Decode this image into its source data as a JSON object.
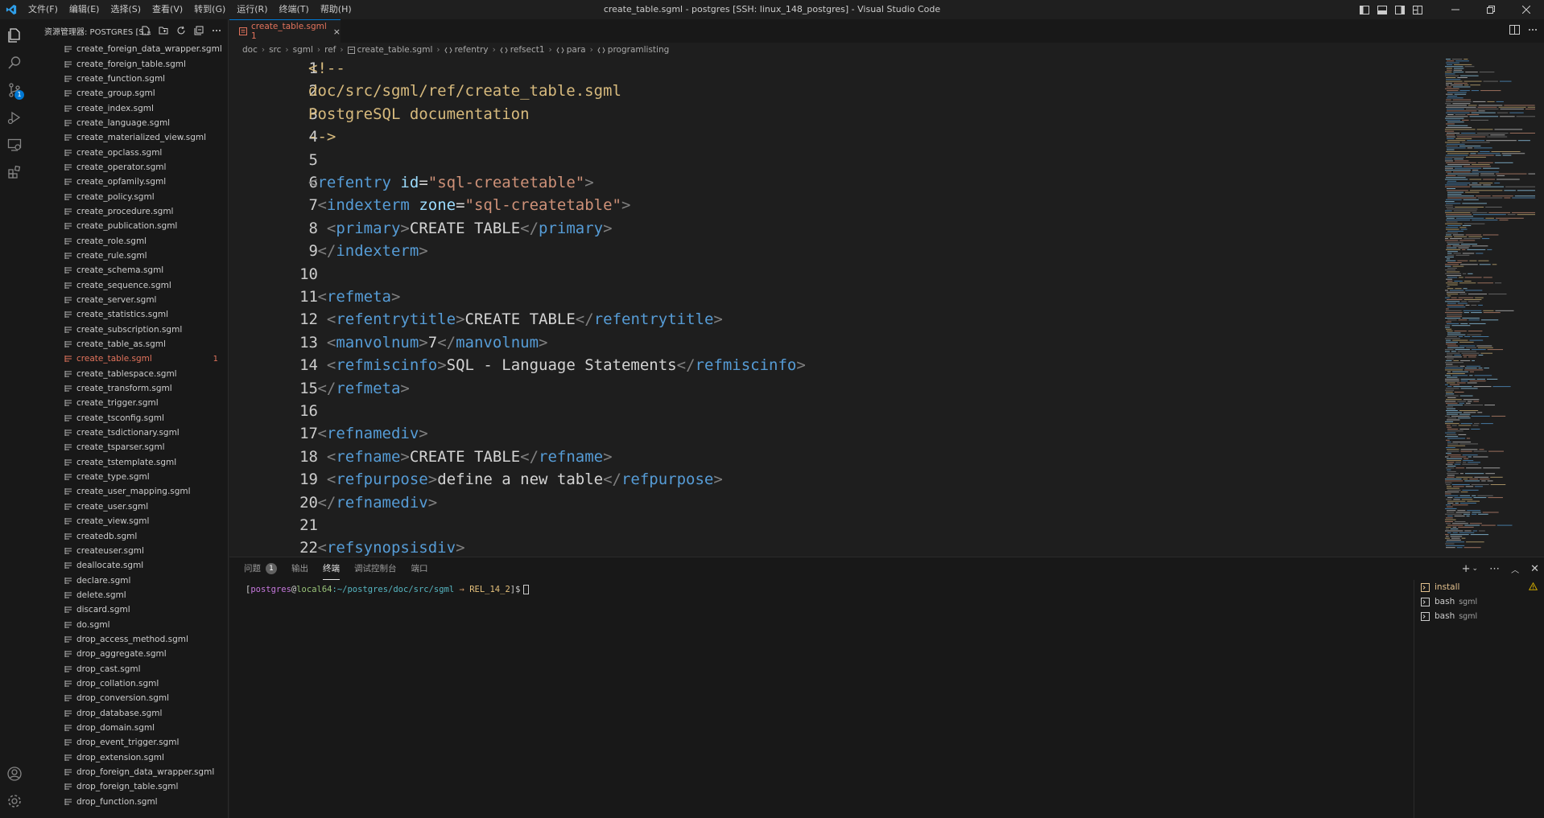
{
  "window": {
    "title": "create_table.sgml - postgres [SSH: linux_148_postgres] - Visual Studio Code",
    "menu": [
      "文件(F)",
      "编辑(E)",
      "选择(S)",
      "查看(V)",
      "转到(G)",
      "运行(R)",
      "终端(T)",
      "帮助(H)"
    ]
  },
  "sidebar": {
    "header": "资源管理器: POSTGRES [S...",
    "files": [
      "create_foreign_data_wrapper.sgml",
      "create_foreign_table.sgml",
      "create_function.sgml",
      "create_group.sgml",
      "create_index.sgml",
      "create_language.sgml",
      "create_materialized_view.sgml",
      "create_opclass.sgml",
      "create_operator.sgml",
      "create_opfamily.sgml",
      "create_policy.sgml",
      "create_procedure.sgml",
      "create_publication.sgml",
      "create_role.sgml",
      "create_rule.sgml",
      "create_schema.sgml",
      "create_sequence.sgml",
      "create_server.sgml",
      "create_statistics.sgml",
      "create_subscription.sgml",
      "create_table_as.sgml",
      "create_table.sgml",
      "create_tablespace.sgml",
      "create_transform.sgml",
      "create_trigger.sgml",
      "create_tsconfig.sgml",
      "create_tsdictionary.sgml",
      "create_tsparser.sgml",
      "create_tstemplate.sgml",
      "create_type.sgml",
      "create_user_mapping.sgml",
      "create_user.sgml",
      "create_view.sgml",
      "createdb.sgml",
      "createuser.sgml",
      "deallocate.sgml",
      "declare.sgml",
      "delete.sgml",
      "discard.sgml",
      "do.sgml",
      "drop_access_method.sgml",
      "drop_aggregate.sgml",
      "drop_cast.sgml",
      "drop_collation.sgml",
      "drop_conversion.sgml",
      "drop_database.sgml",
      "drop_domain.sgml",
      "drop_event_trigger.sgml",
      "drop_extension.sgml",
      "drop_foreign_data_wrapper.sgml",
      "drop_foreign_table.sgml",
      "drop_function.sgml"
    ],
    "active_badge": "1"
  },
  "tab": {
    "label": "create_table.sgml 1",
    "close": "×"
  },
  "breadcrumb": [
    "doc",
    "src",
    "sgml",
    "ref",
    "create_table.sgml",
    "refentry",
    "refsect1",
    "para",
    "programlisting"
  ],
  "editor": {
    "line_numbers": [
      "1",
      "2",
      "3",
      "4",
      "5",
      "6",
      "7",
      "8",
      "9",
      "10",
      "11",
      "12",
      "13",
      "14",
      "15",
      "16",
      "17",
      "18",
      "19",
      "20",
      "21",
      "22"
    ]
  },
  "panel": {
    "tabs": [
      "问题",
      "输出",
      "终端",
      "调试控制台",
      "端口"
    ],
    "problems_count": "1",
    "terminal": {
      "user": "postgres",
      "at": "@",
      "host": "local64",
      "path": ":~/postgres/doc/src/sgml",
      "arrow": " → ",
      "branch": "REL_14_2",
      "suffix": "]$"
    },
    "terminals": [
      {
        "name": "install",
        "sub": ""
      },
      {
        "name": "bash",
        "sub": "sgml"
      },
      {
        "name": "bash",
        "sub": "sgml"
      }
    ]
  },
  "colors": {
    "accent": "#0078d4",
    "modified": "#e2735c",
    "tag": "#569cd6",
    "attribute": "#9cdcfe",
    "string": "#ce9178",
    "comment": "#d7ba7d"
  }
}
